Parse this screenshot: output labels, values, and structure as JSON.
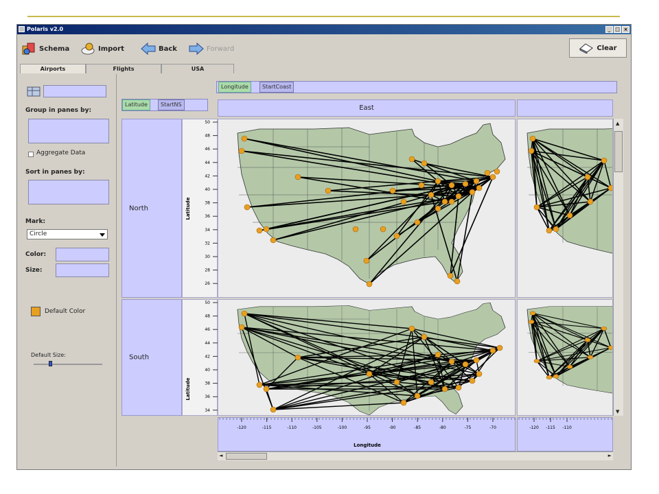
{
  "window": {
    "title": "Polaris v2.0"
  },
  "toolbar": {
    "schema": "Schema",
    "import": "Import",
    "back": "Back",
    "forward": "Forward",
    "clear": "Clear"
  },
  "tabs": [
    {
      "label": "Airports",
      "active": true
    },
    {
      "label": "Flights",
      "active": false
    },
    {
      "label": "USA",
      "active": false
    }
  ],
  "left": {
    "group_label": "Group in panes by:",
    "aggregate_label": "Aggregate Data",
    "sort_label": "Sort in panes by:",
    "mark_label": "Mark:",
    "mark_value": "Circle",
    "color_label": "Color:",
    "size_label": "Size:",
    "default_color_label": "Default Color",
    "default_size_label": "Default Size:"
  },
  "shelves": {
    "col_fields": [
      "Longitude",
      "StartCoast"
    ],
    "row_fields": [
      "Latitude",
      "StartNS"
    ]
  },
  "grid": {
    "columns": [
      "East"
    ],
    "rows": [
      "North",
      "South"
    ],
    "y_axis_label": "Latitude",
    "x_axis_label": "Longitude",
    "y_ticks": [
      "50",
      "48",
      "46",
      "44",
      "42",
      "40",
      "38",
      "36",
      "34",
      "32",
      "30",
      "28",
      "26"
    ],
    "y_ticks_south": [
      "50",
      "48",
      "46",
      "44",
      "42",
      "40",
      "38",
      "36",
      "34"
    ],
    "x_ticks": [
      "-120",
      "-115",
      "-110",
      "-105",
      "-100",
      "-95",
      "-90",
      "-85",
      "-80",
      "-75",
      "-70"
    ],
    "x_ticks_right": [
      "-120",
      "-115",
      "-110"
    ]
  },
  "colors": {
    "mark": "#e8a020",
    "land": "#b4c8a8",
    "shelf": "#ccccff"
  }
}
